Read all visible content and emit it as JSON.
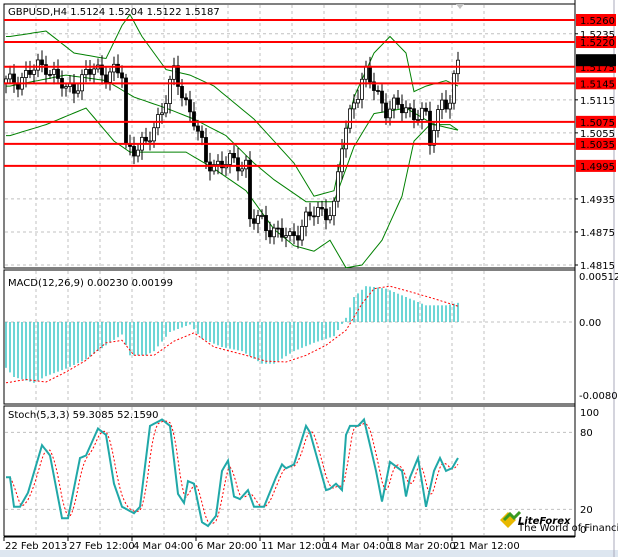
{
  "chart_data": {
    "type": "candlestick",
    "header": {
      "symbol_tf": "GBPUSD,H4",
      "open": "1.5124",
      "high": "1.5204",
      "low": "1.5122",
      "close": "1.5187"
    },
    "price_axis": {
      "ylim": [
        1.4815,
        1.526
      ],
      "ticks": [
        "1.5235",
        "1.5115",
        "1.5055",
        "1.4935",
        "1.4875",
        "1.4815"
      ]
    },
    "current_price": "1.5187",
    "levels": [
      "1.5260",
      "1.5220",
      "1.5175",
      "1.5145",
      "1.5075",
      "1.5035",
      "1.4995"
    ],
    "colors": {
      "levels": "#ff0000",
      "bands": "#008000",
      "hist": "#20c0c0",
      "signal": "#ff0000",
      "stoch_main": "#20a8a8"
    },
    "bar_count": 114,
    "close_keypoints": [
      [
        1,
        1.5145
      ],
      [
        10,
        1.518
      ],
      [
        15,
        1.513
      ],
      [
        22,
        1.517
      ],
      [
        29,
        1.516
      ],
      [
        30,
        1.503
      ],
      [
        35,
        1.503
      ],
      [
        40,
        1.512
      ],
      [
        42,
        1.516
      ],
      [
        47,
        1.508
      ],
      [
        50,
        1.5
      ],
      [
        60,
        1.5
      ],
      [
        61,
        1.49
      ],
      [
        67,
        1.488
      ],
      [
        71,
        1.486
      ],
      [
        75,
        1.49
      ],
      [
        82,
        1.492
      ],
      [
        84,
        1.503
      ],
      [
        87,
        1.512
      ],
      [
        90,
        1.516
      ],
      [
        95,
        1.51
      ],
      [
        100,
        1.51
      ],
      [
        105,
        1.508
      ],
      [
        106,
        1.504
      ],
      [
        109,
        1.512
      ],
      [
        111,
        1.51
      ],
      [
        113,
        1.5187
      ]
    ],
    "bollinger": {
      "upper": [
        [
          1,
          1.523
        ],
        [
          10,
          1.524
        ],
        [
          17,
          1.52
        ],
        [
          25,
          1.519
        ],
        [
          29,
          1.525
        ],
        [
          31,
          1.527
        ],
        [
          34,
          1.523
        ],
        [
          40,
          1.517
        ],
        [
          46,
          1.516
        ],
        [
          52,
          1.514
        ],
        [
          57,
          1.511
        ],
        [
          62,
          1.508
        ],
        [
          67,
          1.504
        ],
        [
          72,
          1.5
        ],
        [
          77,
          1.494
        ],
        [
          82,
          1.495
        ],
        [
          87,
          1.512
        ],
        [
          92,
          1.52
        ],
        [
          96,
          1.523
        ],
        [
          100,
          1.52
        ],
        [
          102,
          1.513
        ],
        [
          105,
          1.514
        ],
        [
          110,
          1.515
        ],
        [
          113,
          1.514
        ]
      ],
      "middle": [
        [
          1,
          1.514
        ],
        [
          15,
          1.516
        ],
        [
          25,
          1.515
        ],
        [
          32,
          1.512
        ],
        [
          40,
          1.51
        ],
        [
          47,
          1.508
        ],
        [
          55,
          1.505
        ],
        [
          62,
          1.5
        ],
        [
          67,
          1.497
        ],
        [
          75,
          1.493
        ],
        [
          82,
          1.493
        ],
        [
          87,
          1.503
        ],
        [
          92,
          1.509
        ],
        [
          100,
          1.51
        ],
        [
          107,
          1.507
        ],
        [
          113,
          1.506
        ]
      ],
      "lower": [
        [
          1,
          1.505
        ],
        [
          10,
          1.507
        ],
        [
          20,
          1.51
        ],
        [
          27,
          1.504
        ],
        [
          31,
          1.502
        ],
        [
          37,
          1.502
        ],
        [
          45,
          1.502
        ],
        [
          52,
          1.499
        ],
        [
          60,
          1.495
        ],
        [
          67,
          1.488
        ],
        [
          72,
          1.485
        ],
        [
          77,
          1.484
        ],
        [
          81,
          1.486
        ],
        [
          85,
          1.481
        ],
        [
          89,
          1.4815
        ],
        [
          94,
          1.486
        ],
        [
          99,
          1.494
        ],
        [
          102,
          1.504
        ],
        [
          106,
          1.507
        ],
        [
          111,
          1.507
        ],
        [
          113,
          1.506
        ]
      ]
    },
    "macd": {
      "label": "MACD(12,26,9) 0.00230 0.00199",
      "ticks": [
        "0.00512",
        "0.00",
        "-0.00803"
      ],
      "hist": [
        [
          0,
          -0.0055
        ],
        [
          2,
          -0.0066
        ],
        [
          7,
          -0.0073
        ],
        [
          10,
          -0.0065
        ],
        [
          15,
          -0.0056
        ],
        [
          20,
          -0.0045
        ],
        [
          25,
          -0.0028
        ],
        [
          29,
          -0.0015
        ],
        [
          31,
          -0.004
        ],
        [
          35,
          -0.004
        ],
        [
          37,
          -0.0035
        ],
        [
          41,
          -0.0012
        ],
        [
          46,
          -0.0003
        ],
        [
          49,
          -0.002
        ],
        [
          54,
          -0.003
        ],
        [
          59,
          -0.0035
        ],
        [
          64,
          -0.005
        ],
        [
          67,
          -0.005
        ],
        [
          72,
          -0.0035
        ],
        [
          77,
          -0.0025
        ],
        [
          82,
          -0.0017
        ],
        [
          85,
          0.0005
        ],
        [
          87,
          0.003
        ],
        [
          90,
          0.0043
        ],
        [
          92,
          0.0042
        ],
        [
          95,
          0.004
        ],
        [
          100,
          0.003
        ],
        [
          105,
          0.002
        ],
        [
          110,
          0.002
        ],
        [
          113,
          0.0023
        ]
      ],
      "signal": [
        [
          0,
          -0.0073
        ],
        [
          5,
          -0.0069
        ],
        [
          10,
          -0.0072
        ],
        [
          15,
          -0.006
        ],
        [
          20,
          -0.0046
        ],
        [
          25,
          -0.0025
        ],
        [
          29,
          -0.0022
        ],
        [
          32,
          -0.004
        ],
        [
          37,
          -0.004
        ],
        [
          42,
          -0.0023
        ],
        [
          47,
          -0.0013
        ],
        [
          52,
          -0.003
        ],
        [
          60,
          -0.004
        ],
        [
          65,
          -0.0047
        ],
        [
          70,
          -0.0048
        ],
        [
          75,
          -0.004
        ],
        [
          80,
          -0.0028
        ],
        [
          85,
          -0.001
        ],
        [
          89,
          0.0022
        ],
        [
          92,
          0.004
        ],
        [
          96,
          0.0043
        ],
        [
          102,
          0.0035
        ],
        [
          107,
          0.0028
        ],
        [
          113,
          0.0019
        ]
      ]
    },
    "stoch": {
      "label": "Stoch(5,3,3) 59.3085 52.1590",
      "ticks": [
        "100",
        "80",
        "20",
        "0"
      ],
      "main": [
        [
          1,
          45
        ],
        [
          2,
          22
        ],
        [
          3.5,
          22
        ],
        [
          5.5,
          33
        ],
        [
          9,
          70
        ],
        [
          11,
          62
        ],
        [
          14,
          13
        ],
        [
          15.5,
          13
        ],
        [
          18.5,
          60
        ],
        [
          20,
          62
        ],
        [
          23,
          83
        ],
        [
          25,
          78
        ],
        [
          27,
          40
        ],
        [
          29,
          22
        ],
        [
          32,
          17
        ],
        [
          33.5,
          22
        ],
        [
          36,
          85
        ],
        [
          39,
          90
        ],
        [
          41,
          85
        ],
        [
          43,
          32
        ],
        [
          44.5,
          25
        ],
        [
          45.5,
          42
        ],
        [
          47,
          40
        ],
        [
          49,
          10
        ],
        [
          50.5,
          7
        ],
        [
          52.5,
          15
        ],
        [
          54,
          50
        ],
        [
          55.5,
          58
        ],
        [
          57,
          30
        ],
        [
          58.5,
          28
        ],
        [
          60.5,
          35
        ],
        [
          62,
          22
        ],
        [
          64.5,
          22
        ],
        [
          67.5,
          45
        ],
        [
          69,
          55
        ],
        [
          70,
          52
        ],
        [
          72,
          55
        ],
        [
          75,
          85
        ],
        [
          76,
          80
        ],
        [
          80,
          35
        ],
        [
          81,
          36
        ],
        [
          82.5,
          40
        ],
        [
          84,
          35
        ],
        [
          85,
          78
        ],
        [
          86,
          85
        ],
        [
          88,
          85
        ],
        [
          89.5,
          90
        ],
        [
          92.5,
          50
        ],
        [
          94,
          26
        ],
        [
          96,
          57
        ],
        [
          99,
          50
        ],
        [
          100,
          30
        ],
        [
          101,
          45
        ],
        [
          103,
          60
        ],
        [
          105,
          22
        ],
        [
          107,
          50
        ],
        [
          108.5,
          60
        ],
        [
          110,
          50
        ],
        [
          111.5,
          52
        ],
        [
          113,
          60
        ]
      ]
    },
    "time_labels": [
      [
        "22 Feb 2013",
        0
      ],
      [
        "27 Feb 12:00",
        16
      ],
      [
        "4 Mar 04:00",
        32
      ],
      [
        "6 Mar 20:00",
        48
      ],
      [
        "11 Mar 12:00",
        64
      ],
      [
        "14 Mar 04:00",
        80
      ],
      [
        "18 Mar 20:00",
        96
      ],
      [
        "21 Mar 12:00",
        112
      ]
    ]
  },
  "logo": {
    "name": "LiteForex",
    "tagline": "The World of Financial Freedom"
  }
}
